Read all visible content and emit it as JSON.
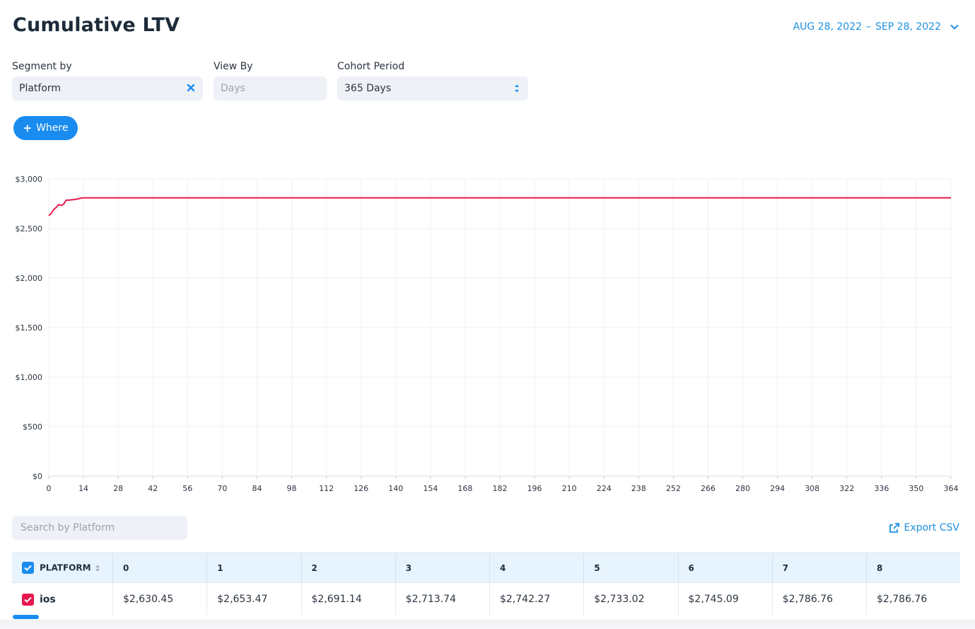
{
  "header": {
    "title": "Cumulative LTV",
    "date_start": "AUG 28, 2022",
    "date_separator": "–",
    "date_end": "SEP 28, 2022"
  },
  "filters": {
    "segment_label": "Segment by",
    "segment_value": "Platform",
    "viewby_label": "View By",
    "viewby_placeholder": "Days",
    "cohort_label": "Cohort Period",
    "cohort_value": "365 Days"
  },
  "where_button": {
    "plus": "+",
    "label": "Where"
  },
  "colors": {
    "accent": "#1a8cf0",
    "series": "#e8184e"
  },
  "chart_data": {
    "type": "line",
    "ylim": [
      0,
      3000
    ],
    "xlim": [
      0,
      364
    ],
    "y_ticks": [
      0,
      500,
      1000,
      1500,
      2000,
      2500,
      3000
    ],
    "y_tick_labels": [
      "$0",
      "$500",
      "$1,000",
      "$1,500",
      "$2,000",
      "$2,500",
      "$3,000"
    ],
    "x_ticks": [
      0,
      14,
      28,
      42,
      56,
      70,
      84,
      98,
      112,
      126,
      140,
      154,
      168,
      182,
      196,
      210,
      224,
      238,
      252,
      266,
      280,
      294,
      308,
      322,
      336,
      350,
      364
    ],
    "grid": true,
    "series": [
      {
        "name": "ios",
        "color": "#e8184e",
        "x": [
          0,
          1,
          2,
          3,
          4,
          5,
          6,
          7,
          8,
          10,
          12,
          13,
          14,
          364
        ],
        "y": [
          2630.45,
          2653.47,
          2691.14,
          2713.74,
          2742.27,
          2733.02,
          2745.09,
          2786.76,
          2786.76,
          2792,
          2800,
          2808,
          2810,
          2810
        ]
      }
    ]
  },
  "search": {
    "placeholder": "Search by Platform"
  },
  "export": {
    "label": "Export CSV"
  },
  "table": {
    "first_header": "PLATFORM",
    "columns": [
      "0",
      "1",
      "2",
      "3",
      "4",
      "5",
      "6",
      "7",
      "8"
    ],
    "rows": [
      {
        "name": "ios",
        "values": [
          "$2,630.45",
          "$2,653.47",
          "$2,691.14",
          "$2,713.74",
          "$2,742.27",
          "$2,733.02",
          "$2,745.09",
          "$2,786.76",
          "$2,786.76"
        ]
      }
    ]
  }
}
